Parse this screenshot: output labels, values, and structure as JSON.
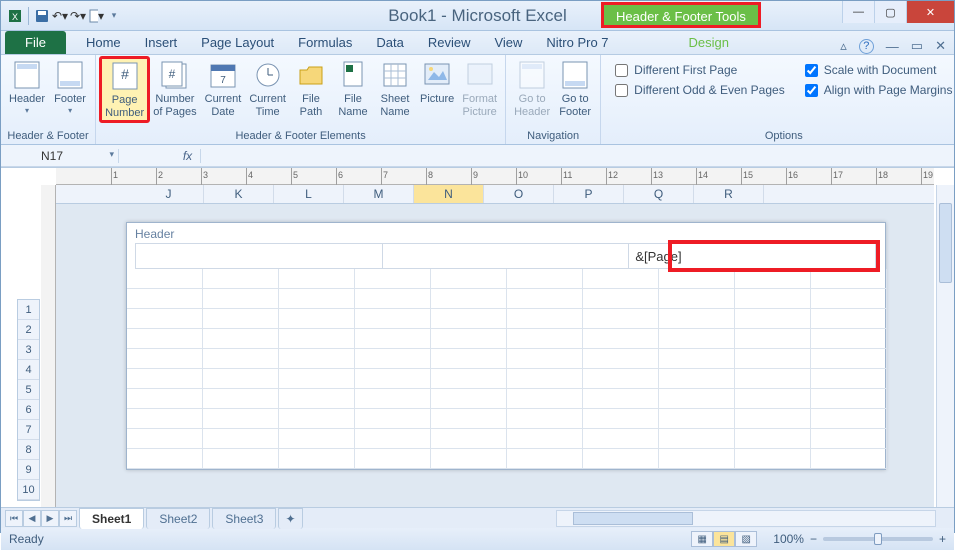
{
  "title": "Book1 - Microsoft Excel",
  "context_tab": "Header & Footer Tools",
  "tabs": [
    "Home",
    "Insert",
    "Page Layout",
    "Formulas",
    "Data",
    "Review",
    "View",
    "Nitro Pro 7"
  ],
  "file_tab": "File",
  "design_tab": "Design",
  "ribbon": {
    "group_hf": "Header & Footer",
    "group_elements": "Header & Footer Elements",
    "group_nav": "Navigation",
    "group_opts": "Options",
    "btn_header": "Header",
    "btn_footer": "Footer",
    "btn_page_number": "Page\nNumber",
    "btn_number_pages": "Number\nof Pages",
    "btn_current_date": "Current\nDate",
    "btn_current_time": "Current\nTime",
    "btn_file_path": "File\nPath",
    "btn_file_name": "File\nName",
    "btn_sheet_name": "Sheet\nName",
    "btn_picture": "Picture",
    "btn_format_picture": "Format\nPicture",
    "btn_goto_header": "Go to\nHeader",
    "btn_goto_footer": "Go to\nFooter",
    "chk_diff_first": "Different First Page",
    "chk_diff_oddeven": "Different Odd & Even Pages",
    "chk_scale": "Scale with Document",
    "chk_align": "Align with Page Margins"
  },
  "checks": {
    "diff_first": false,
    "diff_oddeven": false,
    "scale": true,
    "align": true
  },
  "namebox": "N17",
  "fx": "",
  "columns": [
    "J",
    "K",
    "L",
    "M",
    "N",
    "O",
    "P",
    "Q",
    "R"
  ],
  "current_col": "N",
  "rows": [
    1,
    2,
    3,
    4,
    5,
    6,
    7,
    8,
    9,
    10
  ],
  "header_label": "Header",
  "header_right": "&[Page]",
  "sheets": [
    "Sheet1",
    "Sheet2",
    "Sheet3"
  ],
  "active_sheet": "Sheet1",
  "status_text": "Ready",
  "zoom": "100%",
  "ruler_marks": [
    1,
    2,
    3,
    4,
    5,
    6,
    7,
    8,
    9,
    10,
    11,
    12,
    13,
    14,
    15,
    16,
    17,
    18,
    19
  ]
}
